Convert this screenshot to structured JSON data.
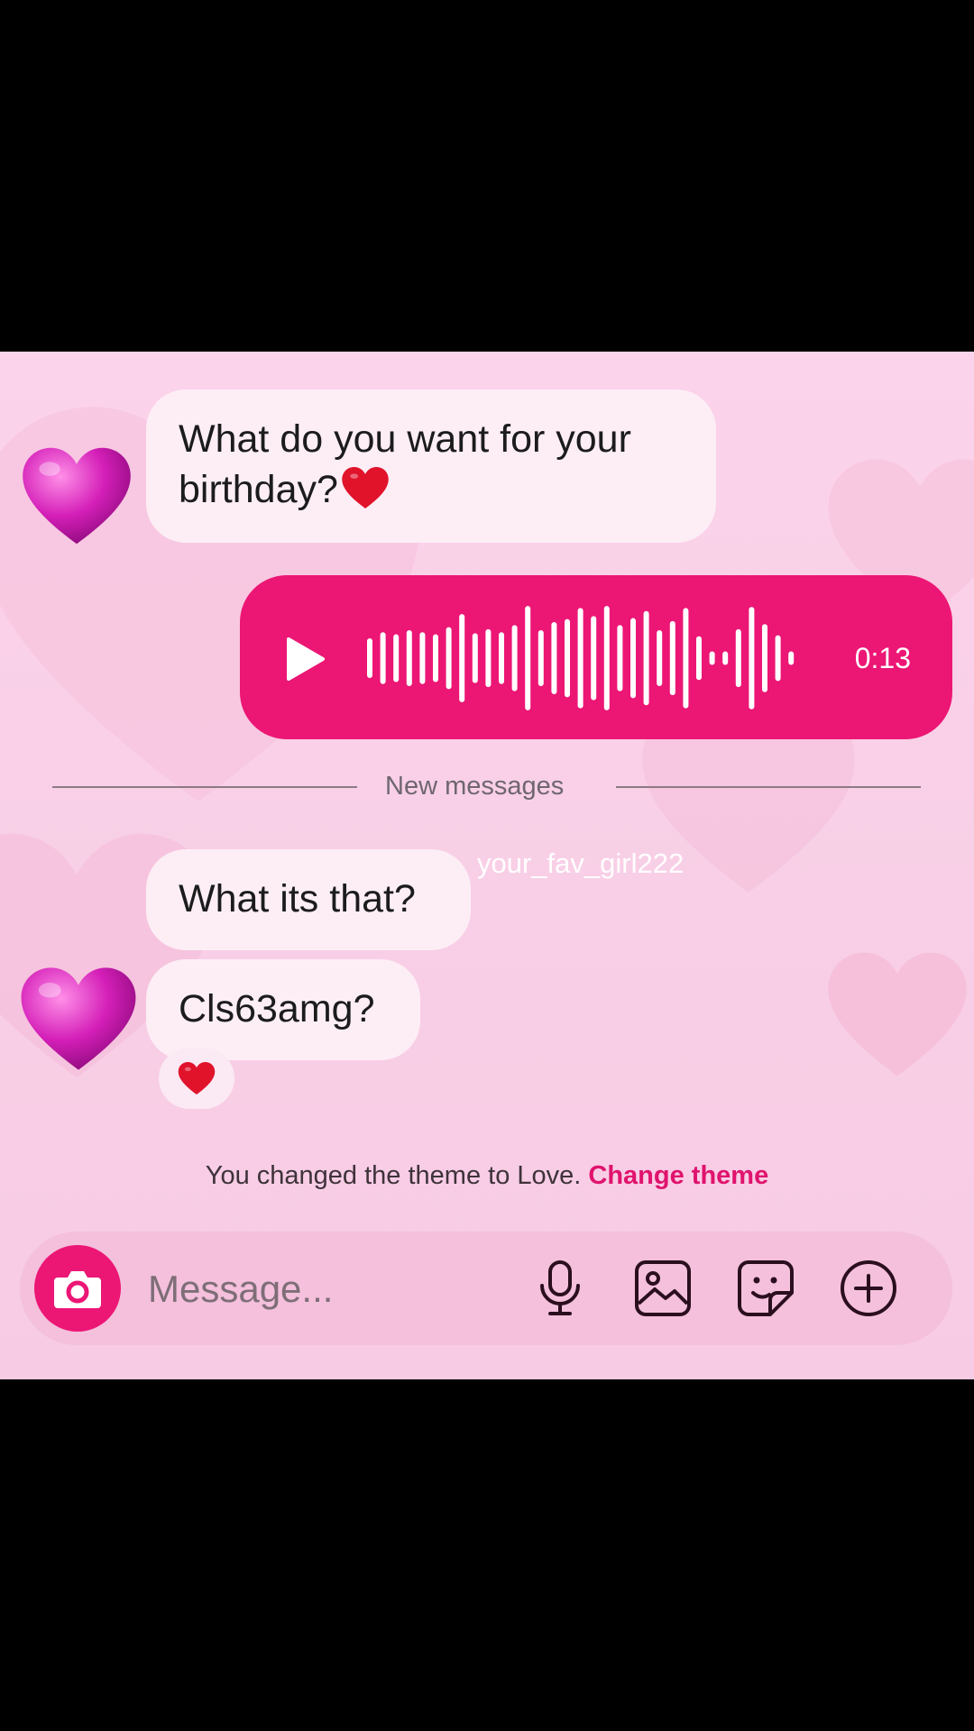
{
  "messages": [
    {
      "text_line1": "What do you want for your",
      "text_line2": "birthday?"
    },
    {
      "text": "What its that?"
    },
    {
      "text": "Cls63amg?"
    }
  ],
  "voice_message": {
    "duration": "0:13"
  },
  "divider": {
    "label": "New messages"
  },
  "overlay_username": "your_fav_girl222",
  "theme_notice": {
    "text": "You changed the theme to Love.",
    "link": "Change theme"
  },
  "composer": {
    "placeholder": "Message..."
  },
  "colors": {
    "accent": "#ec1675",
    "incoming_bubble": "#fdeef6",
    "background": "#fbd3ea"
  },
  "icons": [
    "purple-heart-avatar-icon",
    "red-heart-emoji-icon",
    "play-icon",
    "waveform-icon",
    "camera-icon",
    "microphone-icon",
    "gallery-icon",
    "sticker-icon",
    "plus-circle-icon"
  ]
}
